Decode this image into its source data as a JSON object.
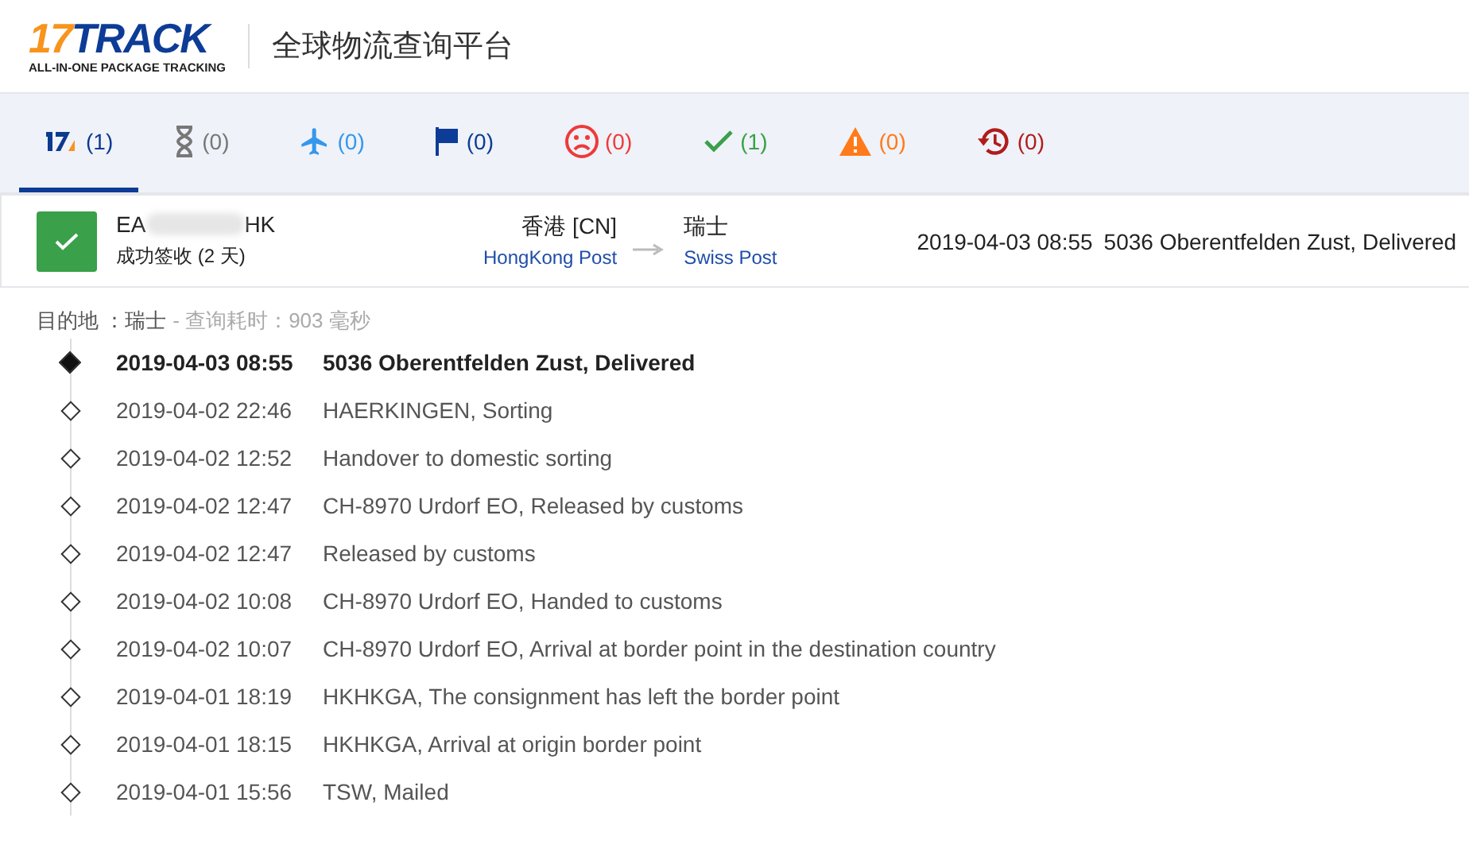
{
  "header": {
    "logo_number": "17",
    "logo_word": "TRACK",
    "logo_tagline": "ALL-IN-ONE PACKAGE TRACKING",
    "title": "全球物流查询平台"
  },
  "tabs": [
    {
      "kind": "all",
      "count": "(1)",
      "color": "#0b3a8f",
      "selected": true
    },
    {
      "kind": "pending",
      "count": "(0)",
      "color": "#777777",
      "selected": false
    },
    {
      "kind": "transit",
      "count": "(0)",
      "color": "#3597ec",
      "selected": false
    },
    {
      "kind": "pickup",
      "count": "(0)",
      "color": "#0d3c96",
      "selected": false
    },
    {
      "kind": "undelivered",
      "count": "(0)",
      "color": "#ee3a3a",
      "selected": false
    },
    {
      "kind": "delivered",
      "count": "(1)",
      "color": "#3aa04a",
      "selected": false
    },
    {
      "kind": "alert",
      "count": "(0)",
      "color": "#ff7a1a",
      "selected": false
    },
    {
      "kind": "expired",
      "count": "(0)",
      "color": "#b01c1c",
      "selected": false
    }
  ],
  "shipment": {
    "number_start": "EA",
    "number_end": "HK",
    "status": "成功签收 (2 天)",
    "origin": "香港 [CN]",
    "origin_carrier": "HongKong Post",
    "destination": "瑞士",
    "destination_carrier": "Swiss Post",
    "latest_time": "2019-04-03 08:55",
    "latest_event": "5036 Oberentfelden Zust, Delivered"
  },
  "summary": {
    "destination_label": "目的地 ：瑞士",
    "query_time": "- 查询耗时：903 毫秒"
  },
  "events": [
    {
      "time": "2019-04-03 08:55",
      "text": "5036 Oberentfelden Zust, Delivered",
      "selected": true
    },
    {
      "time": "2019-04-02 22:46",
      "text": "HAERKINGEN, Sorting",
      "selected": false
    },
    {
      "time": "2019-04-02 12:52",
      "text": "Handover to domestic sorting",
      "selected": false
    },
    {
      "time": "2019-04-02 12:47",
      "text": "CH-8970 Urdorf EO, Released by customs",
      "selected": false
    },
    {
      "time": "2019-04-02 12:47",
      "text": "Released by customs",
      "selected": false
    },
    {
      "time": "2019-04-02 10:08",
      "text": "CH-8970 Urdorf EO, Handed to customs",
      "selected": false
    },
    {
      "time": "2019-04-02 10:07",
      "text": "CH-8970 Urdorf EO, Arrival at border point in the destination country",
      "selected": false
    },
    {
      "time": "2019-04-01 18:19",
      "text": "HKHKGA, The consignment has left the border point",
      "selected": false
    },
    {
      "time": "2019-04-01 18:15",
      "text": "HKHKGA, Arrival at origin border point",
      "selected": false
    },
    {
      "time": "2019-04-01 15:56",
      "text": "TSW, Mailed",
      "selected": false
    }
  ]
}
